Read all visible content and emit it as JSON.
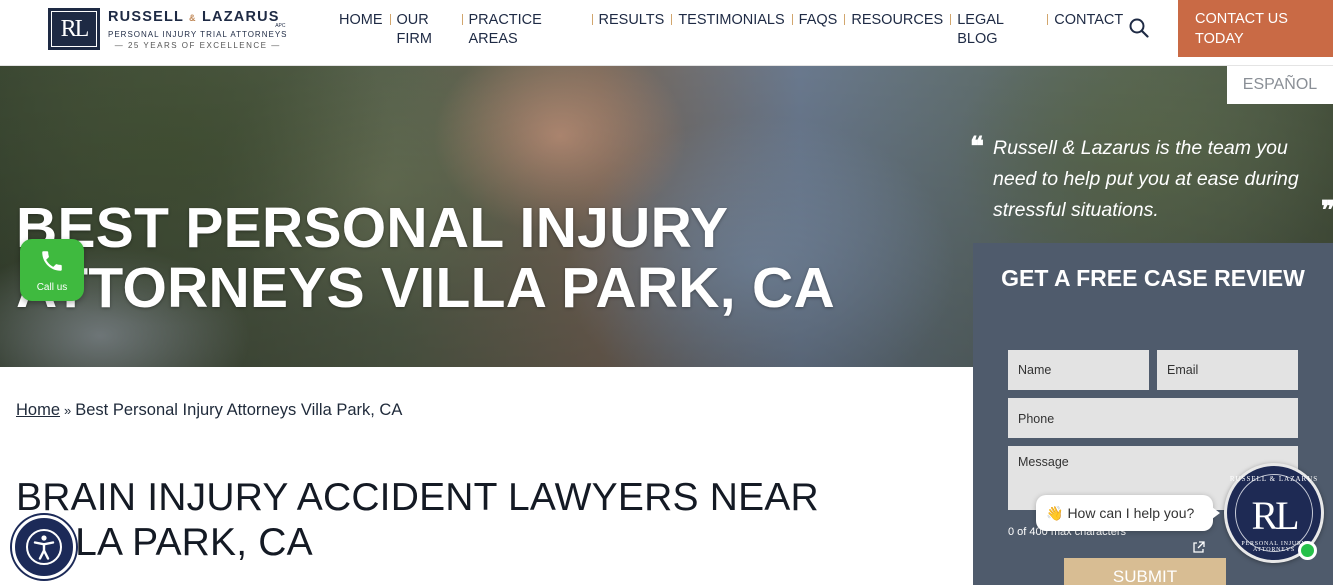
{
  "header": {
    "logo": {
      "monogram": "RL",
      "name_left": "RUSSELL",
      "name_amp": "&",
      "name_right": "LAZARUS",
      "apc": "APC",
      "tagline": "PERSONAL INJURY TRIAL ATTORNEYS",
      "years": "— 25 YEARS OF EXCELLENCE —"
    },
    "nav": [
      {
        "label": "HOME"
      },
      {
        "label": "OUR FIRM"
      },
      {
        "label": "PRACTICE AREAS"
      },
      {
        "label": "RESULTS"
      },
      {
        "label": "TESTIMONIALS"
      },
      {
        "label": "FAQS"
      },
      {
        "label": "RESOURCES"
      },
      {
        "label": "LEGAL BLOG"
      },
      {
        "label": "CONTACT"
      }
    ],
    "search_icon": "search-icon",
    "cta_label": "CONTACT US TODAY",
    "cta_color": "#c96a45"
  },
  "language_toggle": "ESPAÑOL",
  "hero": {
    "title_line1": "BEST PERSONAL INJURY",
    "title_line2": "ATTORNEYS VILLA PARK, CA",
    "quote_open": "❝",
    "quote_close": "❞",
    "quote": "Russell & Lazarus is the team you need to help put you at ease during stressful situations."
  },
  "form": {
    "title": "GET A FREE CASE REVIEW",
    "name_placeholder": "Name",
    "email_placeholder": "Email",
    "phone_placeholder": "Phone",
    "message_placeholder": "Message",
    "counter": "0 of 400 max characters",
    "submit_label": "SUBMIT",
    "background": "#4f5b6c",
    "submit_color": "#d8bd93"
  },
  "breadcrumb": {
    "home": "Home",
    "separator": "»",
    "current": "Best Personal Injury Attorneys Villa Park, CA"
  },
  "content": {
    "heading": "BRAIN INJURY ACCIDENT LAWYERS NEAR VILLA PARK, CA"
  },
  "widgets": {
    "call_label": "Call us",
    "call_color": "#3fba3f",
    "accessibility_icon": "accessibility-icon",
    "chat_prompt": "How can I help you?",
    "chat_wave": "👋",
    "chat_avatar_monogram": "RL",
    "chat_avatar_ring_top": "RUSSELL & LAZARUS",
    "chat_avatar_ring_bottom": "PERSONAL INJURY ATTORNEYS"
  }
}
